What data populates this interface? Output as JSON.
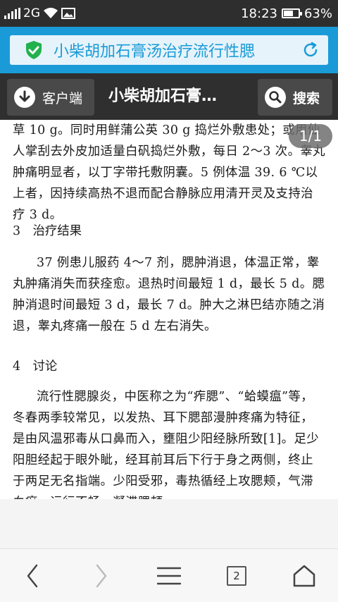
{
  "status_bar": {
    "network": "2G",
    "time": "18:23",
    "battery": "63%",
    "battery_level": 0.63
  },
  "url_bar": {
    "title": "小柴胡加石膏汤治疗流行性腮"
  },
  "toolbar": {
    "client_label": "客户端",
    "page_title": "小柴胡加石膏…",
    "search_label": "搜索"
  },
  "page_indicator": "1/1",
  "article": {
    "para1": "草 10 g。同时用鲜蒲公英 30 g 捣烂外敷患处；或用仙人掌刮去外皮加适量白矾捣烂外敷，每日 2～3 次。睾丸肿痛明显者，以丁字带托敷阴囊。5 例体温 39. 6 ℃以上者，因持续高热不退而配合静脉应用清开灵及支持治疗 3 d。",
    "heading3": "3　治疗结果",
    "para2": "37 例患儿服药 4～7 剂，腮肿消退，体温正常，睾丸肿痛消失而获痊愈。退热时间最短 1 d，最长 5 d。腮肿消退时间最短 3 d，最长 7 d。肿大之淋巴结亦随之消退，睾丸疼痛一般在 5 d 左右消失。",
    "heading4": "4　讨论",
    "para3": "流行性腮腺炎，中医称之为“痄腮”、“蛤蟆瘟”等，冬春两季较常见，以发热、耳下腮部漫肿疼痛为特征，是由风温邪毒从口鼻而入，壅阻少阳经脉所致[1]。足少阳胆经起于眼外眦，经耳前耳后下行于身之两侧，终止于两足无名指端。少阳受邪，毒热循经上攻腮颊，气滞血瘀，运行不畅，凝滞腮颊，"
  },
  "bottom_nav": {
    "tab_count": "2"
  },
  "icons": {
    "shield": "shield-check-icon",
    "refresh": "refresh-icon",
    "download": "download-icon",
    "search": "search-icon",
    "back": "chevron-left-icon",
    "forward": "chevron-right-icon",
    "menu": "menu-icon",
    "tabs": "tabs-icon",
    "home": "home-icon"
  },
  "colors": {
    "accent": "#1a9bd7",
    "shield_green": "#22b14c",
    "toolbar_bg": "#2f2f2f"
  }
}
